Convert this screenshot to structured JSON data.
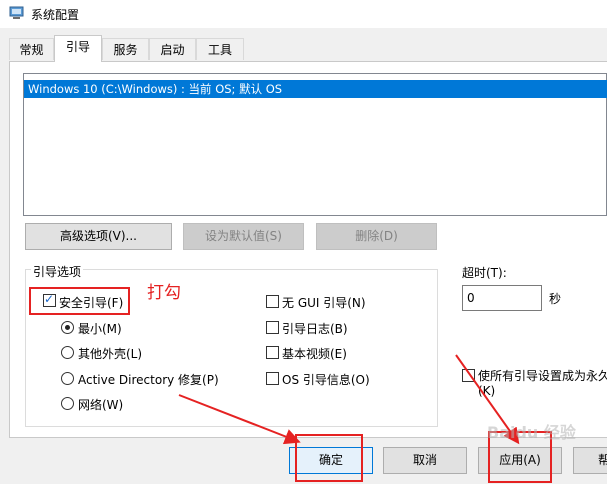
{
  "window": {
    "title": "系统配置"
  },
  "tabs": [
    "常规",
    "引导",
    "服务",
    "启动",
    "工具"
  ],
  "os_list": {
    "items": [
      "Windows 10 (C:\\Windows) : 当前 OS; 默认 OS"
    ]
  },
  "actions": {
    "advanced": "高级选项(V)...",
    "set_default": "设为默认值(S)",
    "delete": "删除(D)"
  },
  "boot_options": {
    "title": "引导选项",
    "safe_boot": "安全引导(F)",
    "radios": [
      "最小(M)",
      "其他外壳(L)",
      "Active Directory 修复(P)",
      "网络(W)"
    ],
    "checks": [
      "无 GUI 引导(N)",
      "引导日志(B)",
      "基本视频(E)",
      "OS 引导信息(O)"
    ]
  },
  "timeout": {
    "label": "超时(T):",
    "value": "0",
    "unit": "秒"
  },
  "permanent": {
    "label_line1": "使所有引导设置成为永久",
    "label_line2": "(K)"
  },
  "annotation": {
    "text": "打勾"
  },
  "footer": {
    "ok": "确定",
    "cancel": "取消",
    "apply": "应用(A)",
    "help": "帮"
  },
  "watermark": "Baidu 经验",
  "colors": {
    "selection": "#0078d7",
    "annotation_red": "#e52222"
  }
}
